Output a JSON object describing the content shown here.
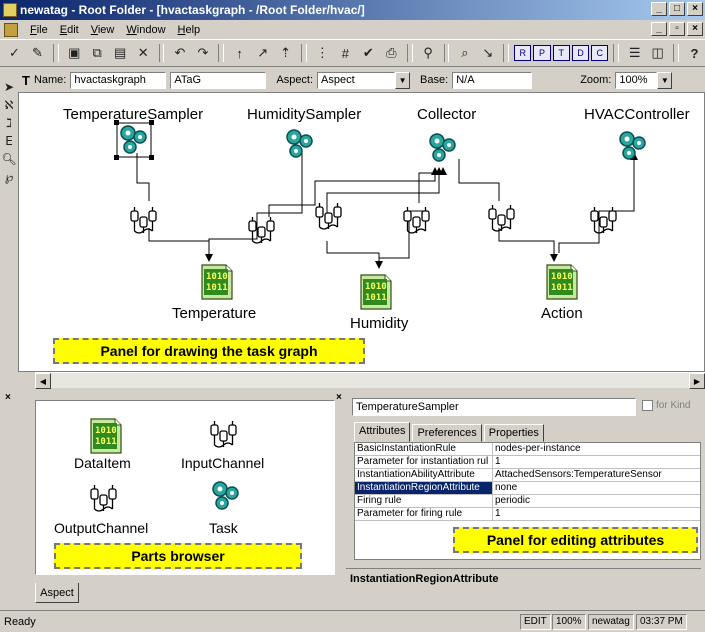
{
  "window": {
    "title": "newatag - Root Folder - [hvactaskgraph - /Root Folder/hvac/]"
  },
  "menu": [
    {
      "label": "File"
    },
    {
      "label": "Edit"
    },
    {
      "label": "View"
    },
    {
      "label": "Window"
    },
    {
      "label": "Help"
    }
  ],
  "toolbar": {
    "icons": [
      "check-icon",
      "pen-icon",
      "save-icon",
      "copy-icon",
      "paste-icon",
      "delete-icon",
      "undo-icon",
      "redo-icon",
      "up-icon",
      "connect-icon",
      "grid-icon",
      "check-all-icon",
      "print-icon",
      "find-icon",
      "zoom-icon",
      "pointer-icon",
      "frame-icons",
      "layout-icons",
      "help-icon"
    ],
    "framed_labels": [
      "R",
      "P",
      "T",
      "D",
      "C"
    ],
    "help_label": "?"
  },
  "namebar": {
    "name_label": "Name:",
    "name_value": "hvactaskgraph",
    "kind_value": "ATaG",
    "aspect_label": "Aspect:",
    "aspect_value": "Aspect",
    "base_label": "Base:",
    "base_value": "N/A",
    "zoom_label": "Zoom:",
    "zoom_value": "100%"
  },
  "graph": {
    "tasks": [
      {
        "label": "TemperatureSampler"
      },
      {
        "label": "HumiditySampler"
      },
      {
        "label": "Collector"
      },
      {
        "label": "HVACController"
      }
    ],
    "data_items": [
      {
        "label": "Temperature"
      },
      {
        "label": "Humidity"
      },
      {
        "label": "Action"
      }
    ],
    "data_glyph": "1010\n1011",
    "callout": "Panel for drawing the task graph"
  },
  "parts": {
    "items": [
      {
        "label": "DataItem"
      },
      {
        "label": "InputChannel"
      },
      {
        "label": "OutputChannel"
      },
      {
        "label": "Task"
      }
    ],
    "callout": "Parts browser",
    "tab": "Aspect"
  },
  "attributes": {
    "object_name": "TemperatureSampler",
    "for_kind": "for Kind",
    "tabs": [
      "Attributes",
      "Preferences",
      "Properties"
    ],
    "rows": [
      {
        "k": "BasicInstantiationRule",
        "v": "nodes-per-instance"
      },
      {
        "k": "Parameter for instantiation rul",
        "v": "1"
      },
      {
        "k": "InstantiationAbilityAttribute",
        "v": "AttachedSensors:TemperatureSensor"
      },
      {
        "k": "InstantiationRegionAttribute",
        "v": "none"
      },
      {
        "k": "Firing rule",
        "v": "periodic"
      },
      {
        "k": "Parameter for firing rule",
        "v": "1"
      }
    ],
    "callout": "Panel for editing attributes",
    "description": "InstantiationRegionAttribute"
  },
  "status": {
    "text": "Ready",
    "mode": "EDIT",
    "zoom": "100%",
    "project": "newatag",
    "time": "03:37 PM"
  }
}
